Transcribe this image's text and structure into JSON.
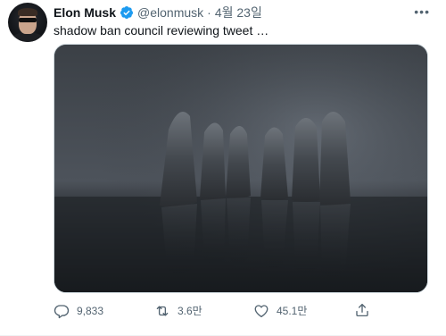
{
  "author": {
    "name": "Elon Musk",
    "handle": "@elonmusk",
    "separator": "·",
    "date": "4월 23일",
    "verified": true,
    "verified_color": "#1d9bf0"
  },
  "tweet": {
    "text": "shadow ban council reviewing tweet …"
  },
  "media": {
    "alt": "Six hooded cloaked figures standing in a circle on a reflective floor"
  },
  "actions": {
    "reply_count": "9,833",
    "retweet_count": "3.6만",
    "like_count": "45.1만"
  },
  "icons": {
    "more": "more-icon",
    "reply": "reply-icon",
    "retweet": "retweet-icon",
    "like": "like-icon",
    "share": "share-icon",
    "verified": "verified-badge-icon"
  },
  "colors": {
    "text_primary": "#0f1419",
    "text_secondary": "#536471",
    "brand": "#1d9bf0"
  }
}
